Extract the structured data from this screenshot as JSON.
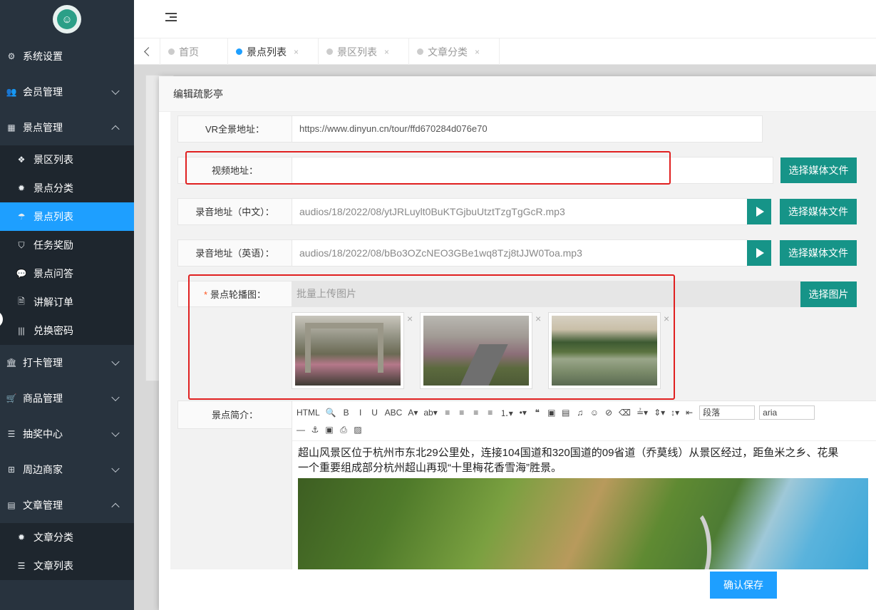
{
  "sidebar": {
    "logo_glyph": "☺",
    "items": [
      {
        "name": "menu-system-settings",
        "icon": "gears-icon",
        "glyph": "⚙",
        "label": "系统设置",
        "chevron": ""
      },
      {
        "name": "menu-member-management",
        "icon": "users-icon",
        "glyph": "👥",
        "label": "会员管理",
        "chevron": "down"
      },
      {
        "name": "menu-attraction-management",
        "icon": "grid-icon",
        "glyph": "▦",
        "label": "景点管理",
        "chevron": "up"
      }
    ],
    "attraction_sub": [
      {
        "name": "sub-scenic-list",
        "icon": "cubes-icon",
        "glyph": "❖",
        "label": "景区列表",
        "active": false
      },
      {
        "name": "sub-attraction-category",
        "icon": "gear-icon",
        "glyph": "✹",
        "label": "景点分类",
        "active": false
      },
      {
        "name": "sub-attraction-list",
        "icon": "umbrella-icon",
        "glyph": "☂",
        "label": "景点列表",
        "active": true
      },
      {
        "name": "sub-task-rewards",
        "icon": "shield-icon",
        "glyph": "⛉",
        "label": "任务奖励",
        "active": false
      },
      {
        "name": "sub-attraction-qa",
        "icon": "chat-icon",
        "glyph": "💬",
        "label": "景点问答",
        "active": false
      },
      {
        "name": "sub-guide-orders",
        "icon": "file-icon",
        "glyph": "🗎",
        "label": "讲解订单",
        "active": false
      },
      {
        "name": "sub-redeem-codes",
        "icon": "barcode-icon",
        "glyph": "|||",
        "label": "兑换密码",
        "active": false
      }
    ],
    "items_after": [
      {
        "name": "menu-checkin-management",
        "icon": "bank-icon",
        "glyph": "🏛",
        "label": "打卡管理",
        "chevron": "down"
      },
      {
        "name": "menu-product-management",
        "icon": "cart-icon",
        "glyph": "🛒",
        "label": "商品管理",
        "chevron": "down"
      },
      {
        "name": "menu-lottery-center",
        "icon": "database-icon",
        "glyph": "☰",
        "label": "抽奖中心",
        "chevron": "down"
      },
      {
        "name": "menu-nearby-merchants",
        "icon": "sitemap-icon",
        "glyph": "⊞",
        "label": "周边商家",
        "chevron": "down"
      },
      {
        "name": "menu-article-management",
        "icon": "newspaper-icon",
        "glyph": "▤",
        "label": "文章管理",
        "chevron": "up"
      }
    ],
    "article_sub": [
      {
        "name": "sub-article-category",
        "icon": "gear-icon",
        "glyph": "✹",
        "label": "文章分类"
      },
      {
        "name": "sub-article-list",
        "icon": "list-icon",
        "glyph": "☰",
        "label": "文章列表"
      }
    ]
  },
  "tabs": [
    {
      "label": "首页",
      "active": false,
      "closable": false
    },
    {
      "label": "景点列表",
      "active": true,
      "closable": true
    },
    {
      "label": "景区列表",
      "active": false,
      "closable": true
    },
    {
      "label": "文章分类",
      "active": false,
      "closable": true
    }
  ],
  "modal": {
    "title": "编辑疏影亭",
    "save_label": "确认保存"
  },
  "form": {
    "vr_label": "VR全景地址：",
    "vr_value": "https://www.dinyun.cn/tour/ffd670284d076e70",
    "video_label": "视频地址：",
    "video_value": "",
    "select_media_label": "选择媒体文件",
    "audio_cn_label": "录音地址（中文）：",
    "audio_cn_value": "audios/18/2022/08/ytJRLuylt0BuKTGjbuUtztTzgTgGcR.mp3",
    "audio_en_label": "录音地址（英语）：",
    "audio_en_value": "audios/18/2022/08/bBo3OZcNEO3GBe1wq8Tzj8tJJW0Toa.mp3",
    "carousel_label": "景点轮播图：",
    "carousel_placeholder": "批量上传图片",
    "select_image_label": "选择图片",
    "remove_glyph": "×",
    "intro_label": "景点简介："
  },
  "editor": {
    "toolbar_row1": [
      "HTML",
      "🔍",
      "B",
      "I",
      "U",
      "ABC",
      "A▾",
      "ab▾",
      "≡",
      "≡",
      "≡",
      "≡",
      "⒈▾",
      "•▾",
      "❝",
      "▣",
      "▤",
      "♫",
      "☺",
      "⊘",
      "⌫",
      "≟▾",
      "⇕▾",
      "↕▾",
      "⇤"
    ],
    "paragraph_select": "段落",
    "font_select": "aria",
    "toolbar_row2": [
      "—",
      "⚓",
      "▣",
      "⎙",
      "▨"
    ],
    "content_line1": "超山风景区位于杭州市东北29公里处，连接104国道和320国道的09省道（乔莫线）从景区经过，距鱼米之乡、花果",
    "content_line2": "一个重要组成部分杭州超山再现“十里梅花香雪海”胜景。"
  },
  "colors": {
    "sidebar_bg": "#28333e",
    "active_blue": "#1e9fff",
    "teal": "#169488",
    "highlight_red": "#e02020"
  }
}
